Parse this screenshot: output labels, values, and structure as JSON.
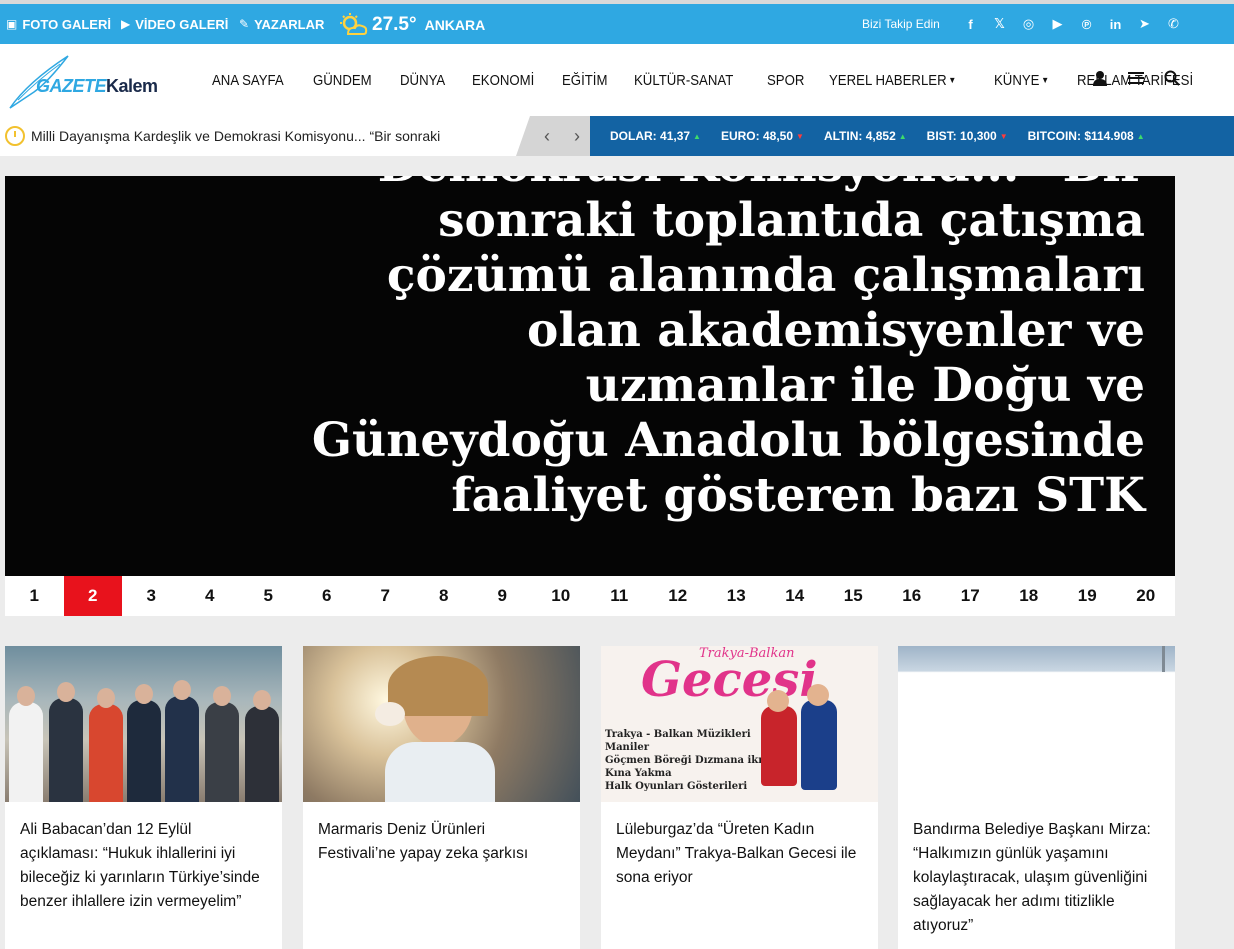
{
  "topbar": {
    "foto_galeri": "FOTO GALERİ",
    "video_galeri": "VİDEO GALERİ",
    "yazarlar": "YAZARLAR",
    "temperature": "27.5°",
    "city": "ANKARA",
    "follow_label": "Bizi Takip Edin",
    "social_icons": [
      "facebook-icon",
      "x-icon",
      "instagram-icon",
      "youtube-icon",
      "pinterest-icon",
      "linkedin-icon",
      "telegram-icon",
      "whatsapp-icon"
    ]
  },
  "header": {
    "logo_part1": "GAZETE",
    "logo_part2": "Kalem",
    "nav": [
      "ANA SAYFA",
      "GÜNDEM",
      "DÜNYA",
      "EKONOMİ",
      "EĞİTİM",
      "KÜLTÜR-SANAT",
      "SPOR",
      "YEREL HABERLER",
      "KÜNYE",
      "REKLAM TARİFESİ"
    ]
  },
  "ticker": {
    "text": "Milli Dayanışma Kardeşlik ve Demokrasi Komisyonu... “Bir sonraki"
  },
  "market": [
    {
      "label": "DOLAR:",
      "value": "41,37",
      "trend": "up"
    },
    {
      "label": "EURO:",
      "value": "48,50",
      "trend": "down"
    },
    {
      "label": "ALTIN:",
      "value": "4,852",
      "trend": "up"
    },
    {
      "label": "BIST:",
      "value": "10,300",
      "trend": "down"
    },
    {
      "label": "BITCOIN:",
      "value": "$114.908",
      "trend": "up"
    }
  ],
  "hero": {
    "lines": [
      "Demokrasi Komisyonu... “Bir",
      "sonraki toplantıda çatışma",
      "çözümü alanında çalışmaları",
      "olan akademisyenler ve",
      "uzmanlar ile Doğu ve",
      "Güneydoğu Anadolu bölgesinde",
      "faaliyet gösteren bazı STK"
    ]
  },
  "pager": {
    "pages": [
      "1",
      "2",
      "3",
      "4",
      "5",
      "6",
      "7",
      "8",
      "9",
      "10",
      "11",
      "12",
      "13",
      "14",
      "15",
      "16",
      "17",
      "18",
      "19",
      "20"
    ],
    "active": "2"
  },
  "cards": [
    {
      "title": "Ali Babacan’dan 12 Eylül açıklaması: “Hukuk ihlallerini iyi bileceğiz ki yarınların Türkiye’sinde benzer ihlallere izin vermeyelim”"
    },
    {
      "title": "Marmaris Deniz Ürünleri Festivali’ne yapay zeka şarkısı"
    },
    {
      "title": "Lüleburgaz’da “Üreten Kadın Meydanı” Trakya-Balkan Gecesi ile sona eriyor",
      "image_title": "Gecesi",
      "image_subtitle": "Trakya-Balkan",
      "image_list": [
        "Trakya - Balkan Müzikleri",
        "Maniler",
        "Göçmen Böreği Dızmana ikramı",
        "Kına Yakma",
        "Halk Oyunları Gösterileri"
      ]
    },
    {
      "title": "Bandırma Belediye Başkanı Mirza: “Halkımızın günlük yaşamını kolaylaştıracak, ulaşım güvenliğini sağlayacak her adımı titizlikle atıyoruz”"
    }
  ]
}
